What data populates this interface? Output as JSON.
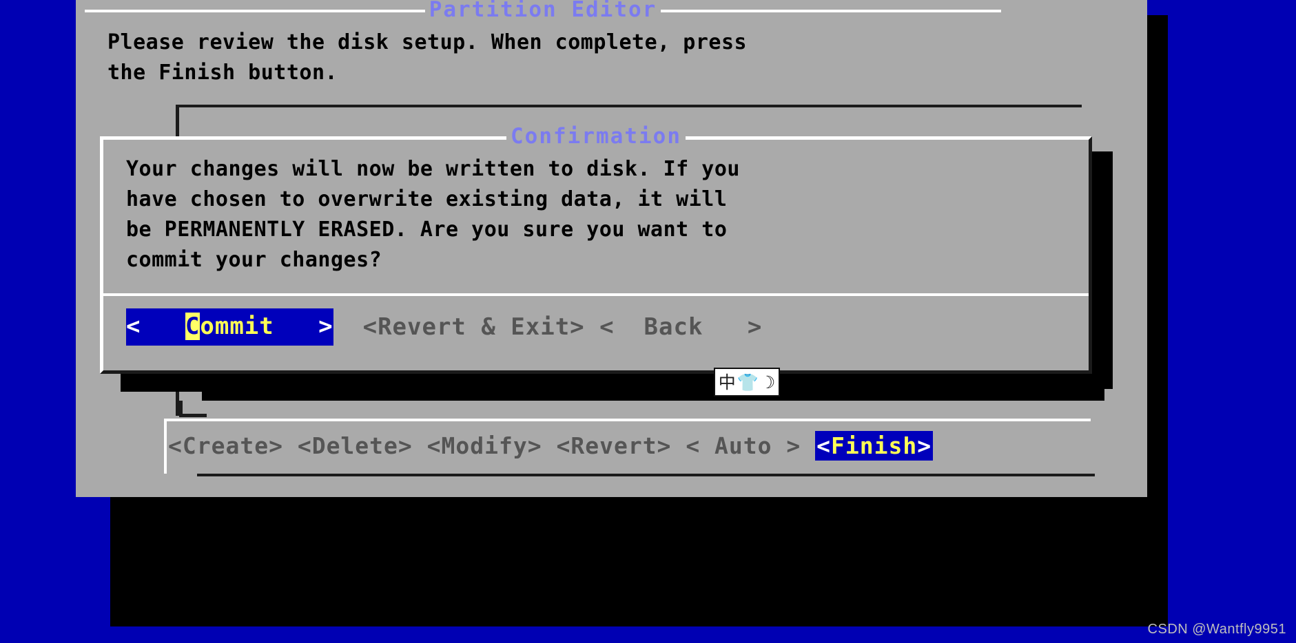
{
  "desktop": {
    "background_color": "#0000b3"
  },
  "partition_editor": {
    "title": "Partition Editor",
    "intro_text": "Please review the disk setup. When complete, press\nthe Finish button.",
    "actions": [
      {
        "name": "create",
        "label": "<Create>",
        "selected": false
      },
      {
        "name": "delete",
        "label": "<Delete>",
        "selected": false
      },
      {
        "name": "modify",
        "label": "<Modify>",
        "selected": false
      },
      {
        "name": "revert",
        "label": "<Revert>",
        "selected": false
      },
      {
        "name": "auto",
        "label": "< Auto >",
        "selected": false
      }
    ],
    "finish_button": {
      "bracket_left": "<",
      "label": "Finish",
      "bracket_right": ">",
      "selected": true
    }
  },
  "confirmation": {
    "title": "Confirmation",
    "message": "Your changes will now be written to disk. If you\nhave chosen to overwrite existing data, it will\nbe PERMANENTLY ERASED. Are you sure you want to\ncommit your changes?",
    "commit_button": {
      "bracket_left": "<",
      "pad_left": "   ",
      "cursor_char": "C",
      "rest_label": "ommit",
      "pad_right": "   ",
      "bracket_right": ">",
      "selected": true
    },
    "other_buttons": [
      {
        "name": "revert-and-exit",
        "label": "<Revert & Exit>",
        "selected": false
      },
      {
        "name": "back",
        "label": "<  Back   >",
        "selected": false
      }
    ]
  },
  "ime_indicator": {
    "mode_glyph": "中",
    "shape_glyph": "👕",
    "extra_glyph": "☽",
    "mode_name": "chinese-mode",
    "shape_name": "halfwidth-shape",
    "extra_name": "crescent-moon"
  },
  "watermark": {
    "text": "CSDN @Wantfly9951"
  },
  "colors": {
    "desktop_blue": "#0000b3",
    "dialog_gray": "#aaaaaa",
    "title_blue": "#7b7bf0",
    "highlight_blue": "#0000bb",
    "highlight_yellow": "#ffff55",
    "cursor_yellow": "#ffff66",
    "dim_text": "#555555",
    "body_text": "#000000",
    "shadow": "#000000"
  }
}
